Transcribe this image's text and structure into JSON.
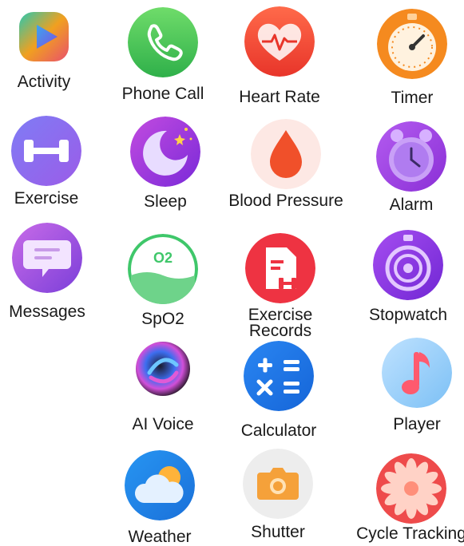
{
  "apps": [
    {
      "id": "activity",
      "label": "Activity"
    },
    {
      "id": "phone-call",
      "label": "Phone Call"
    },
    {
      "id": "heart-rate",
      "label": "Heart Rate"
    },
    {
      "id": "timer",
      "label": "Timer"
    },
    {
      "id": "exercise",
      "label": "Exercise"
    },
    {
      "id": "sleep",
      "label": "Sleep"
    },
    {
      "id": "blood-pressure",
      "label": "Blood Pressure"
    },
    {
      "id": "alarm",
      "label": "Alarm"
    },
    {
      "id": "messages",
      "label": "Messages"
    },
    {
      "id": "spo2",
      "label": "SpO2",
      "icon_text": "O2"
    },
    {
      "id": "exercise-records",
      "label": "Exercise\nRecords"
    },
    {
      "id": "stopwatch",
      "label": "Stopwatch"
    },
    {
      "id": "ai-voice",
      "label": "AI Voice"
    },
    {
      "id": "calculator",
      "label": "Calculator"
    },
    {
      "id": "player",
      "label": "Player"
    },
    {
      "id": "weather",
      "label": "Weather"
    },
    {
      "id": "shutter",
      "label": "Shutter"
    },
    {
      "id": "cycle-tracking",
      "label": "Cycle Tracking"
    }
  ]
}
